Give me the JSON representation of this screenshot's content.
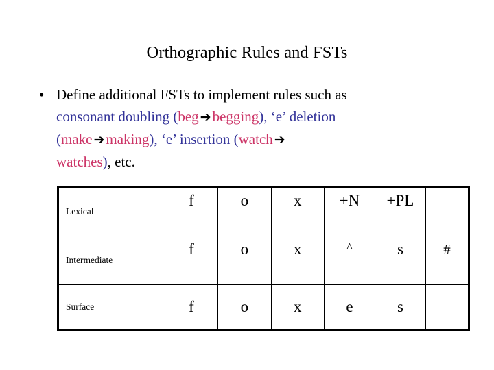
{
  "slide": {
    "title": "Orthographic Rules and FSTs",
    "colors": {
      "text_black": "#000000",
      "text_blue": "#333399",
      "text_pink": "#CC3366",
      "background": "#FFFFFF",
      "table_border": "#000000"
    }
  },
  "bullet": {
    "marker": "•",
    "line1": "Define additional FSTs to implement rules such as",
    "line2_a": "consonant doubling (",
    "line2_b": "beg",
    "line2_arrow": "➔",
    "line2_c": "begging",
    "line2_d": "), ‘e’ deletion",
    "line3_a": "(",
    "line3_b": "make",
    "line3_arrow": "➔",
    "line3_c": "making",
    "line3_d": "), ‘e’ insertion (",
    "line3_e": "watch",
    "line3_arrow2": "➔",
    "line4_a": "watches",
    "line4_b": ")",
    "line4_c": ", etc."
  },
  "table": {
    "columns": [
      "level",
      "seg1",
      "seg2",
      "seg3",
      "seg4",
      "seg5",
      "seg6"
    ],
    "rows": [
      {
        "label": "Lexical",
        "cells": [
          "f",
          "o",
          "x",
          "+N",
          "+PL",
          ""
        ]
      },
      {
        "label": "Intermediate",
        "cells": [
          "f",
          "o",
          "x",
          "^",
          "s",
          "#"
        ]
      },
      {
        "label": "Surface",
        "cells": [
          "f",
          "o",
          "x",
          "e",
          "s",
          ""
        ]
      }
    ]
  }
}
